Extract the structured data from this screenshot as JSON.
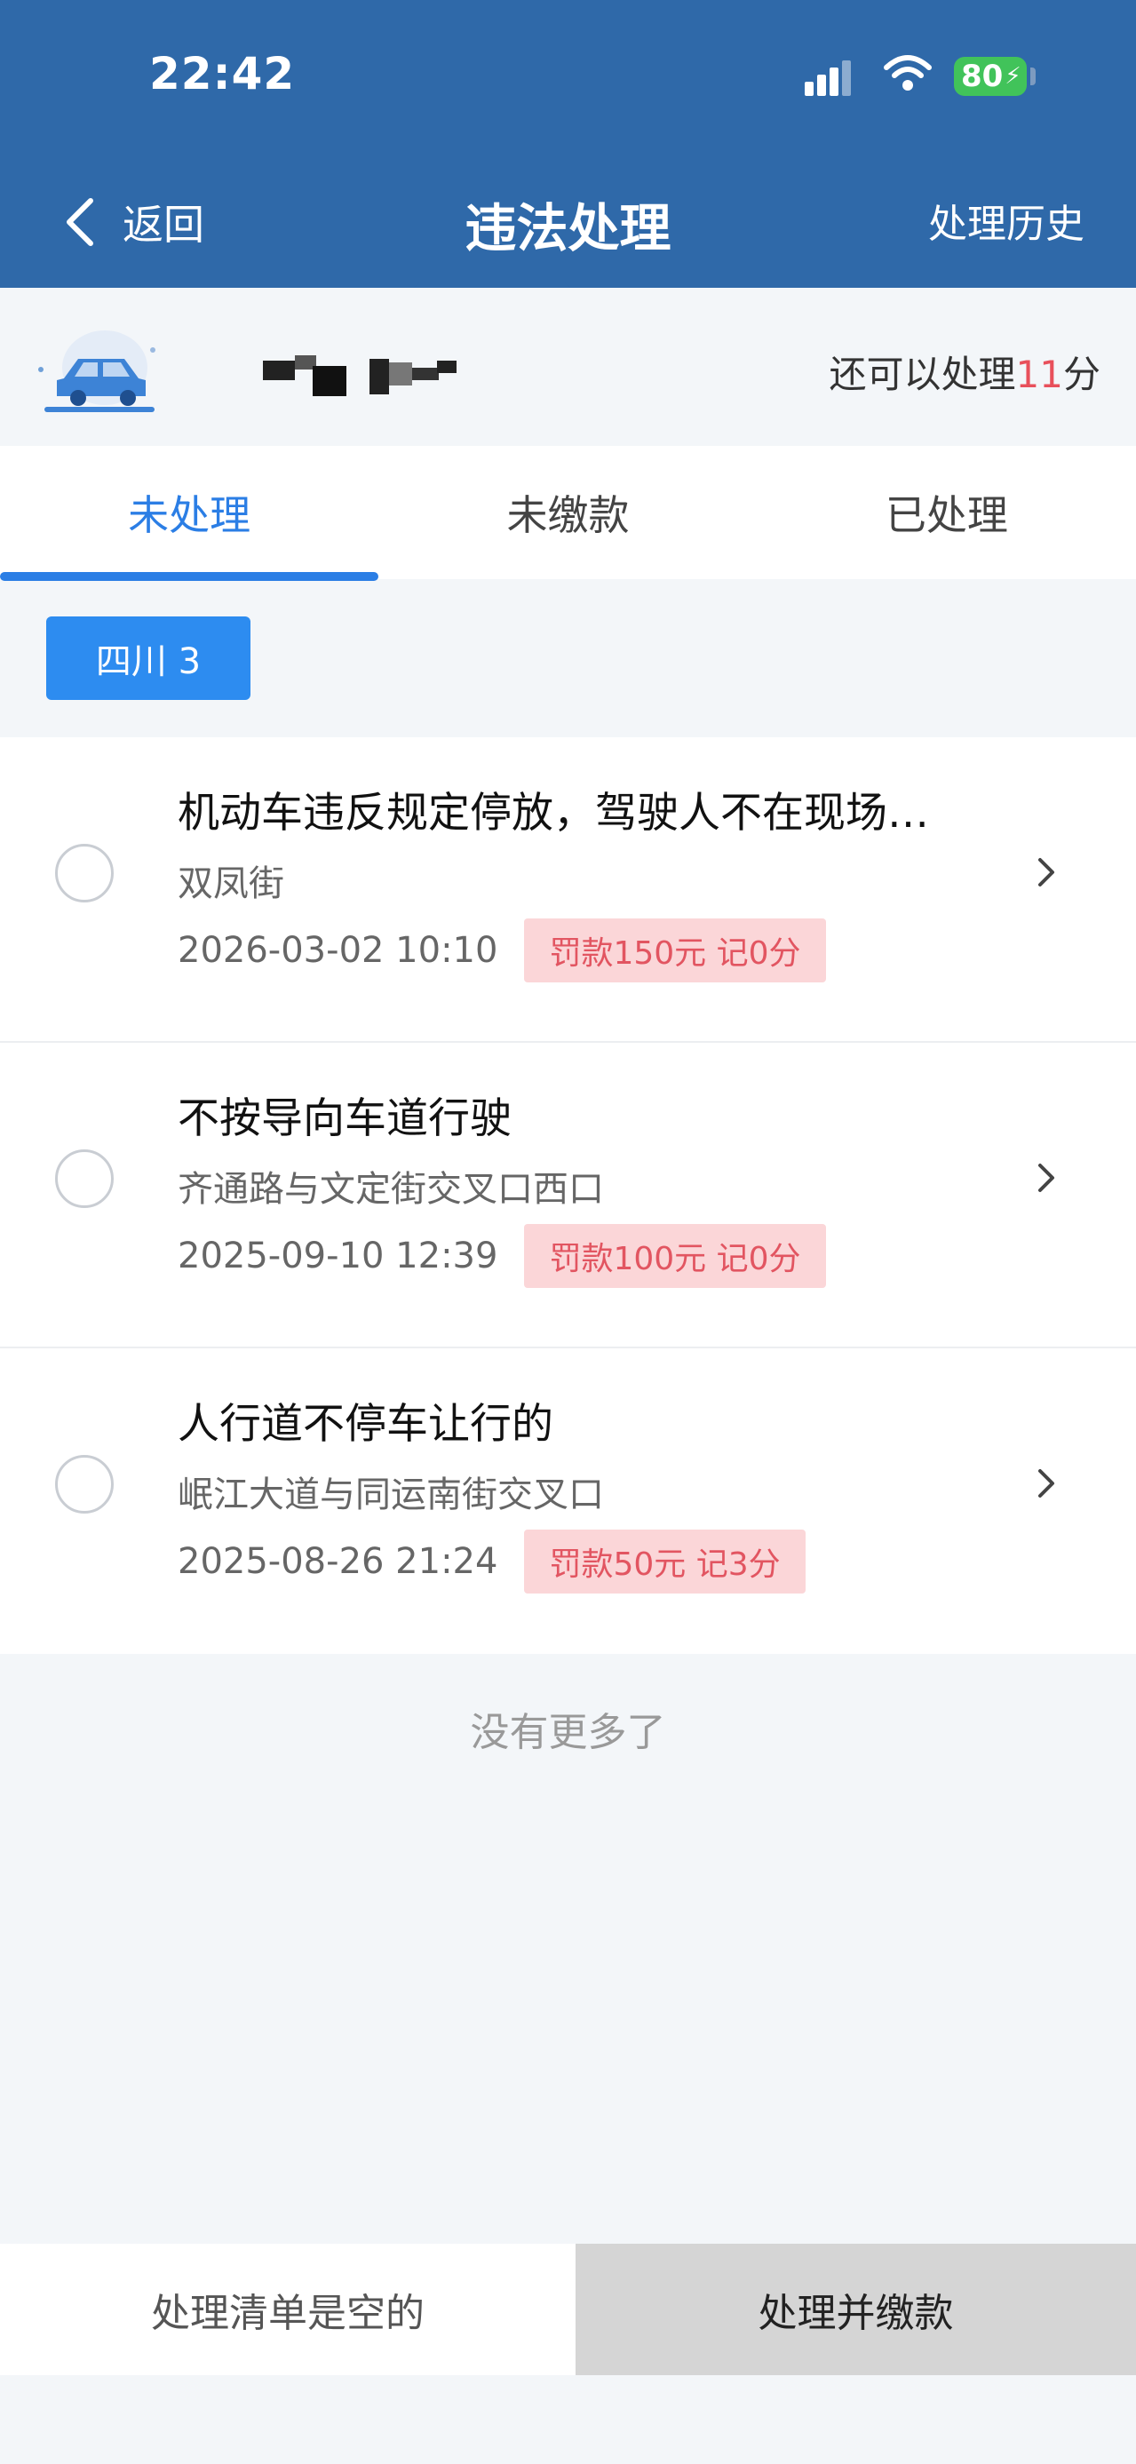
{
  "status_bar": {
    "time": "22:42",
    "battery": "80"
  },
  "nav": {
    "back_label": "返回",
    "title": "违法处理",
    "history_label": "处理历史"
  },
  "vehicle": {
    "points_prefix": "还可以处理",
    "points_value": "11",
    "points_suffix": "分"
  },
  "tabs": [
    {
      "label": "未处理",
      "active": true
    },
    {
      "label": "未缴款",
      "active": false
    },
    {
      "label": "已处理",
      "active": false
    }
  ],
  "filter": {
    "label": "四川 3"
  },
  "violations": [
    {
      "title": "机动车违反规定停放，驾驶人不在现场…",
      "place": "双凤街",
      "time": "2026-03-02 10:10",
      "badge": "罚款150元 记0分"
    },
    {
      "title": "不按导向车道行驶",
      "place": "齐通路与文定街交叉口西口",
      "time": "2025-09-10 12:39",
      "badge": "罚款100元 记0分"
    },
    {
      "title": "人行道不停车让行的",
      "place": "岷江大道与同运南街交叉口",
      "time": "2025-08-26 21:24",
      "badge": "罚款50元 记3分"
    }
  ],
  "footer": {
    "no_more": "没有更多了"
  },
  "bottom": {
    "list_status": "处理清单是空的",
    "action_label": "处理并缴款"
  },
  "colors": {
    "header": "#2f69a9",
    "accent": "#2b7ee5",
    "badge_bg": "#fbd6d8",
    "badge_text": "#e25561"
  }
}
